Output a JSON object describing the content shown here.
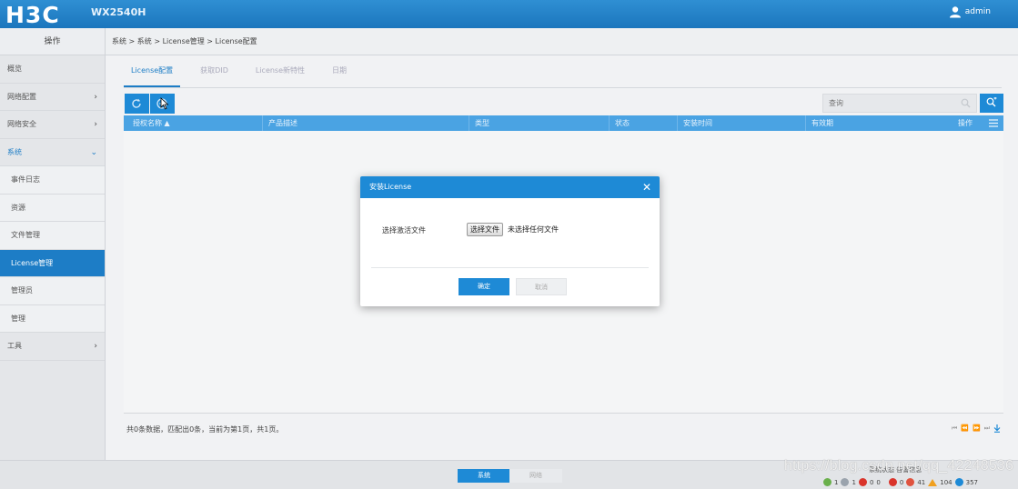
{
  "header": {
    "logo": "H3C",
    "model": "WX2540H",
    "user": "admin"
  },
  "sidebar": {
    "title": "操作",
    "items": [
      {
        "label": "概览",
        "chevron": ""
      },
      {
        "label": "网络配置",
        "chevron": "›"
      },
      {
        "label": "网络安全",
        "chevron": "›"
      },
      {
        "label": "系统",
        "chevron": "⌄"
      },
      {
        "label": "事件日志",
        "chevron": ""
      },
      {
        "label": "资源",
        "chevron": ""
      },
      {
        "label": "文件管理",
        "chevron": ""
      },
      {
        "label": "License管理",
        "chevron": ""
      },
      {
        "label": "管理员",
        "chevron": ""
      },
      {
        "label": "管理",
        "chevron": ""
      },
      {
        "label": "工具",
        "chevron": "›"
      }
    ]
  },
  "breadcrumb": "系统 > 系统 > License管理 > License配置",
  "tabs": [
    "License配置",
    "获取DID",
    "License新特性",
    "日期"
  ],
  "search": {
    "placeholder": "查询"
  },
  "table": {
    "columns": [
      "授权名称 ▲",
      "产品描述",
      "类型",
      "状态",
      "安装时间",
      "有效期",
      "操作"
    ]
  },
  "footer_info": "共0条数据，匹配出0条，当前为第1页，共1页。",
  "pager": [
    "⏮",
    "⏪",
    "⏩",
    "⏭"
  ],
  "bottom": {
    "system_btn": "系统",
    "network_btn": "网络",
    "status_label": "系统状态  告警信息",
    "counts": {
      "green": "1",
      "gray": "1",
      "red_a": "0",
      "zero": "0",
      "red_b": "0",
      "red_c": "41",
      "warn": "104",
      "info": "357"
    }
  },
  "watermark": "https://blog.csdn.net/qq_42248536",
  "modal": {
    "title": "安装License",
    "close": "✕",
    "label": "选择激活文件",
    "file_button": "选择文件",
    "file_status": "未选择任何文件",
    "ok": "确定",
    "cancel": "取消"
  },
  "colors": {
    "primary": "#1e8ad6",
    "topbar": "#1b76bd",
    "active": "#1d7dc6"
  }
}
